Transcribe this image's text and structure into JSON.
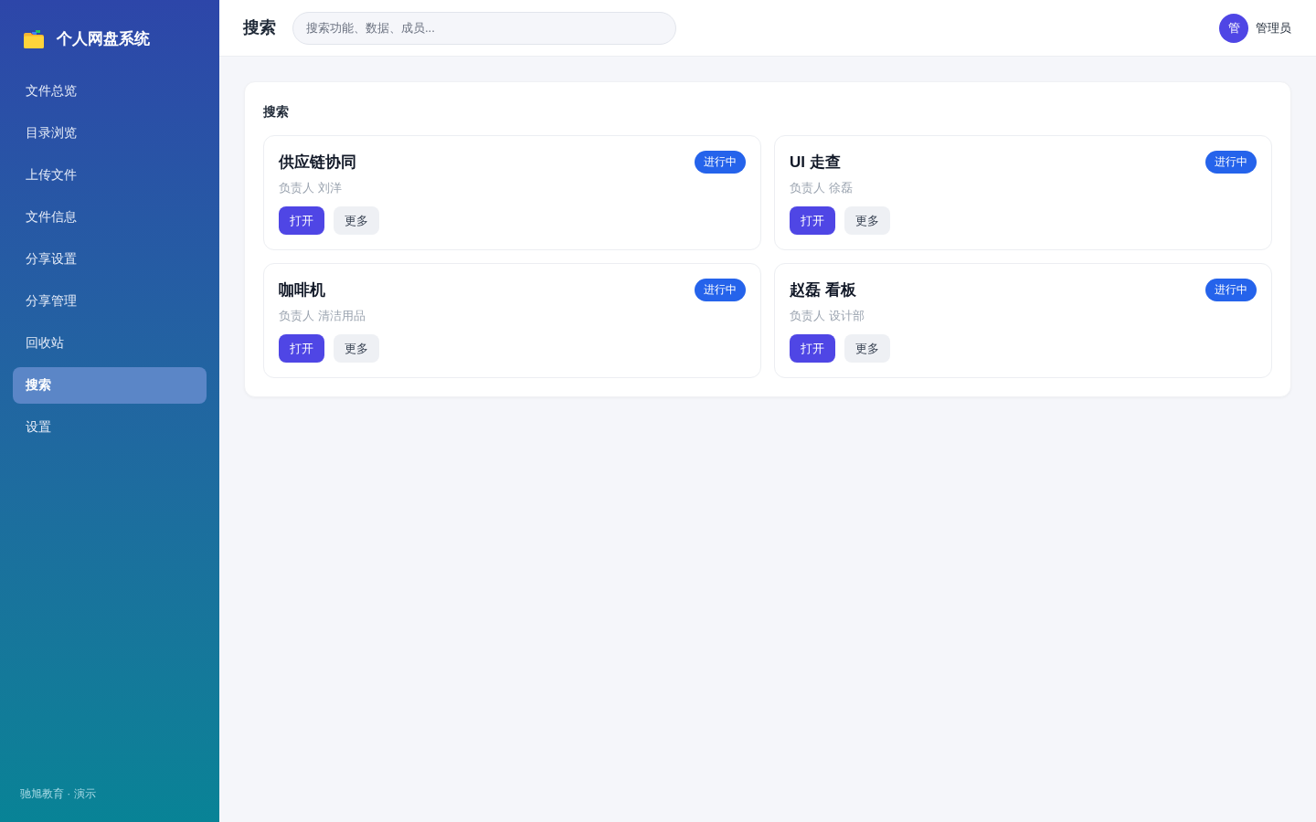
{
  "sidebar": {
    "brand": "个人网盘系统",
    "items": [
      {
        "label": "文件总览",
        "selected": false
      },
      {
        "label": "目录浏览",
        "selected": false
      },
      {
        "label": "上传文件",
        "selected": false
      },
      {
        "label": "文件信息",
        "selected": false
      },
      {
        "label": "分享设置",
        "selected": false
      },
      {
        "label": "分享管理",
        "selected": false
      },
      {
        "label": "回收站",
        "selected": false
      },
      {
        "label": "搜索",
        "selected": true
      },
      {
        "label": "设置",
        "selected": false
      }
    ],
    "footer": "驰旭教育 · 演示"
  },
  "header": {
    "title": "搜索",
    "search": {
      "placeholder": "搜索功能、数据、成员..."
    },
    "user": {
      "avatar": "管",
      "name": "管理员"
    }
  },
  "panel": {
    "title": "搜索",
    "cards": [
      {
        "title": "供应链协同",
        "status": "进行中",
        "owner": "负责人 刘洋",
        "actions": [
          {
            "label": "打开",
            "kind": "primary"
          },
          {
            "label": "更多",
            "kind": "secondary"
          }
        ]
      },
      {
        "title": "UI 走查",
        "status": "进行中",
        "owner": "负责人 徐磊",
        "actions": [
          {
            "label": "打开",
            "kind": "primary"
          },
          {
            "label": "更多",
            "kind": "secondary"
          }
        ]
      },
      {
        "title": "咖啡机",
        "status": "进行中",
        "owner": "负责人 清洁用品",
        "actions": [
          {
            "label": "打开",
            "kind": "primary"
          },
          {
            "label": "更多",
            "kind": "secondary"
          }
        ]
      },
      {
        "title": "赵磊 看板",
        "status": "进行中",
        "owner": "负责人 设计部",
        "actions": [
          {
            "label": "打开",
            "kind": "primary"
          },
          {
            "label": "更多",
            "kind": "secondary"
          }
        ]
      }
    ]
  }
}
